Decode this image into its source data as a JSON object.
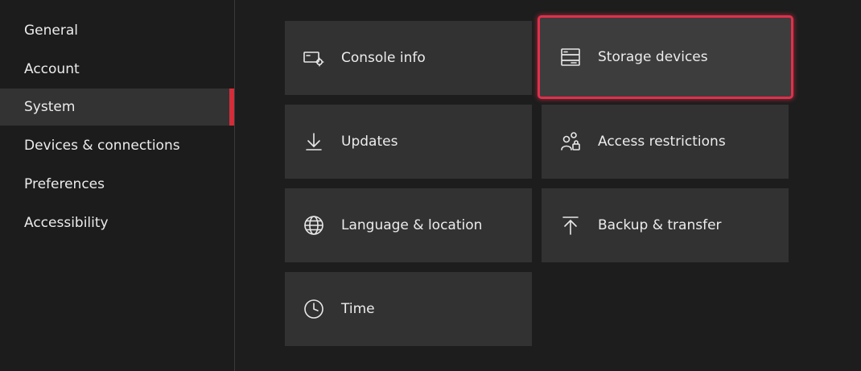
{
  "nav": {
    "items": [
      {
        "label": "General"
      },
      {
        "label": "Account"
      },
      {
        "label": "System",
        "selected": true
      },
      {
        "label": "Devices & connections"
      },
      {
        "label": "Preferences"
      },
      {
        "label": "Accessibility"
      }
    ]
  },
  "tiles": {
    "console_info": {
      "label": "Console info",
      "icon": "console-info-icon"
    },
    "storage_devices": {
      "label": "Storage devices",
      "icon": "storage-icon",
      "focused": true
    },
    "updates": {
      "label": "Updates",
      "icon": "download-icon"
    },
    "access_restrictions": {
      "label": "Access restrictions",
      "icon": "people-lock-icon"
    },
    "language_location": {
      "label": "Language & location",
      "icon": "globe-icon"
    },
    "backup_transfer": {
      "label": "Backup & transfer",
      "icon": "upload-icon"
    },
    "time": {
      "label": "Time",
      "icon": "clock-icon"
    }
  },
  "colors": {
    "background": "#1d1d1d",
    "tile": "#323232",
    "selected_nav": "#333333",
    "accent": "#e0304b"
  }
}
